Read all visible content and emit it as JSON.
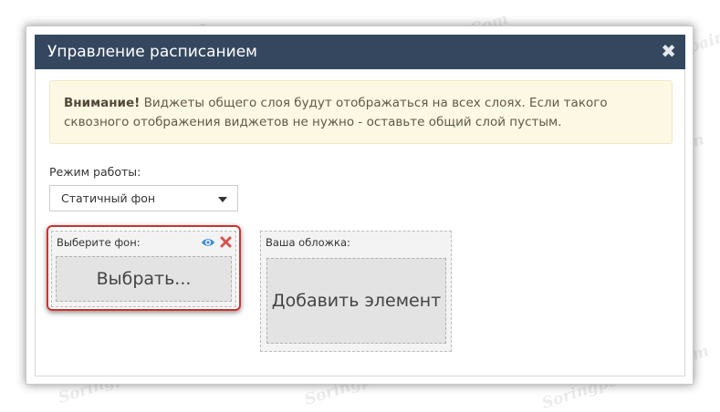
{
  "dialog": {
    "title": "Управление расписанием",
    "close_glyph": "✖"
  },
  "alert": {
    "strong": "Внимание!",
    "text": " Виджеты общего слоя будут отображаться на всех слоях. Если такого сквозного отображения виджетов не нужно - оставьте общий слой пустым."
  },
  "mode": {
    "label": "Режим работы:",
    "selected": "Статичный фон"
  },
  "background_panel": {
    "label": "Выберите фон:",
    "button": "Выбрать...",
    "eye_icon": "eye-icon",
    "remove_icon": "close-x-icon"
  },
  "cover_panel": {
    "label": "Ваша обложка:",
    "button": "Добавить элемент"
  },
  "watermark": {
    "text": "Soringpcrepair.Com"
  },
  "colors": {
    "titlebar": "#34475f",
    "alert_bg": "#fcf8e3",
    "highlight": "#d0312d",
    "eye": "#3d8fd1",
    "remove": "#d9534f"
  }
}
